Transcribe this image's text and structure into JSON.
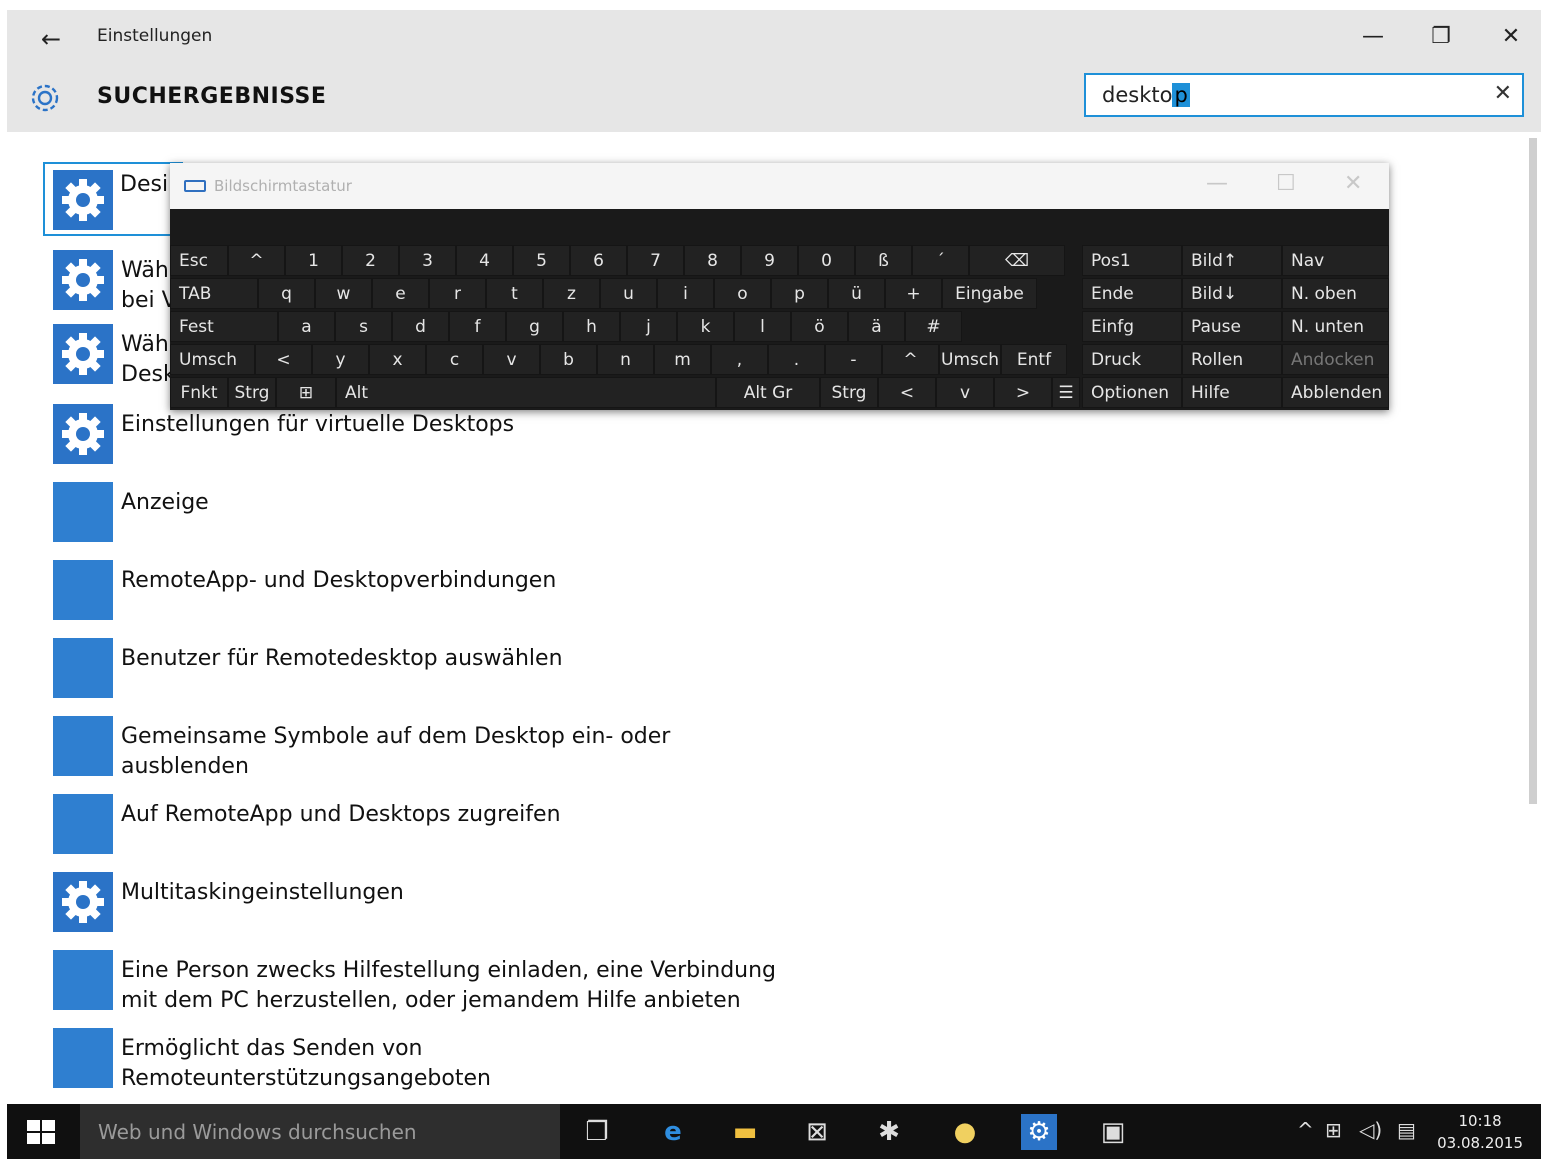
{
  "window": {
    "title": "Einstellungen",
    "back_icon": "←",
    "minimize_icon": "—",
    "maximize_icon": "❐",
    "close_icon": "✕"
  },
  "header": {
    "heading": "SUCHERGEBNISSE",
    "search_value_before": "deskto",
    "search_value_selected": "p",
    "clear_icon": "✕"
  },
  "results": [
    {
      "label": "Desi",
      "icon": "gear"
    },
    {
      "label": "Wähl",
      "label2": "bei V",
      "icon": "gear"
    },
    {
      "label": "Wähl",
      "label2": "Desk",
      "icon": "gear"
    },
    {
      "label": "Einstellungen für virtuelle Desktops",
      "icon": "gear"
    },
    {
      "label": "Anzeige",
      "icon": "monitor"
    },
    {
      "label": "RemoteApp- und Desktopverbindungen",
      "icon": "remote"
    },
    {
      "label": "Benutzer für Remotedesktop auswählen",
      "icon": "system"
    },
    {
      "label": "Gemeinsame Symbole auf dem Desktop ein- oder",
      "label2": "ausblenden",
      "icon": "personalize"
    },
    {
      "label": "Auf RemoteApp und Desktops zugreifen",
      "icon": "remote"
    },
    {
      "label": "Multitaskingeinstellungen",
      "icon": "gear"
    },
    {
      "label": "Eine Person zwecks Hilfestellung einladen, eine Verbindung",
      "label2": "mit dem PC herzustellen, oder jemandem Hilfe anbieten",
      "icon": "system"
    },
    {
      "label": "Ermöglicht das Senden von",
      "label2": "Remoteunterstützungsangeboten",
      "icon": "system"
    }
  ],
  "osk": {
    "title": "Bildschirmtastatur",
    "minimize_icon": "—",
    "maximize_icon": "☐",
    "close_icon": "✕",
    "row1": [
      "Esc",
      "^",
      "1",
      "2",
      "3",
      "4",
      "5",
      "6",
      "7",
      "8",
      "9",
      "0",
      "ß",
      "´",
      "⌫"
    ],
    "row2": [
      "TAB",
      "q",
      "w",
      "e",
      "r",
      "t",
      "z",
      "u",
      "i",
      "o",
      "p",
      "ü",
      "+",
      "Eingabe"
    ],
    "row3": [
      "Fest",
      "a",
      "s",
      "d",
      "f",
      "g",
      "h",
      "j",
      "k",
      "l",
      "ö",
      "ä",
      "#"
    ],
    "row4": [
      "Umsch",
      "<",
      "y",
      "x",
      "c",
      "v",
      "b",
      "n",
      "m",
      ",",
      ".",
      "-",
      "^",
      "Umsch",
      "Entf"
    ],
    "row5": [
      "Fnkt",
      "Strg",
      "⊞",
      "Alt",
      "Alt Gr",
      "Strg",
      "<",
      "v",
      ">",
      "☰"
    ],
    "nav": [
      [
        "Pos1",
        "Bild↑",
        "Nav"
      ],
      [
        "Ende",
        "Bild↓",
        "N. oben"
      ],
      [
        "Einfg",
        "Pause",
        "N. unten"
      ],
      [
        "Druck",
        "Rollen",
        "Andocken"
      ],
      [
        "Optionen",
        "Hilfe",
        "Abblenden"
      ]
    ]
  },
  "taskbar": {
    "search_placeholder": "Web und Windows durchsuchen",
    "time": "10:18",
    "date": "03.08.2015"
  }
}
